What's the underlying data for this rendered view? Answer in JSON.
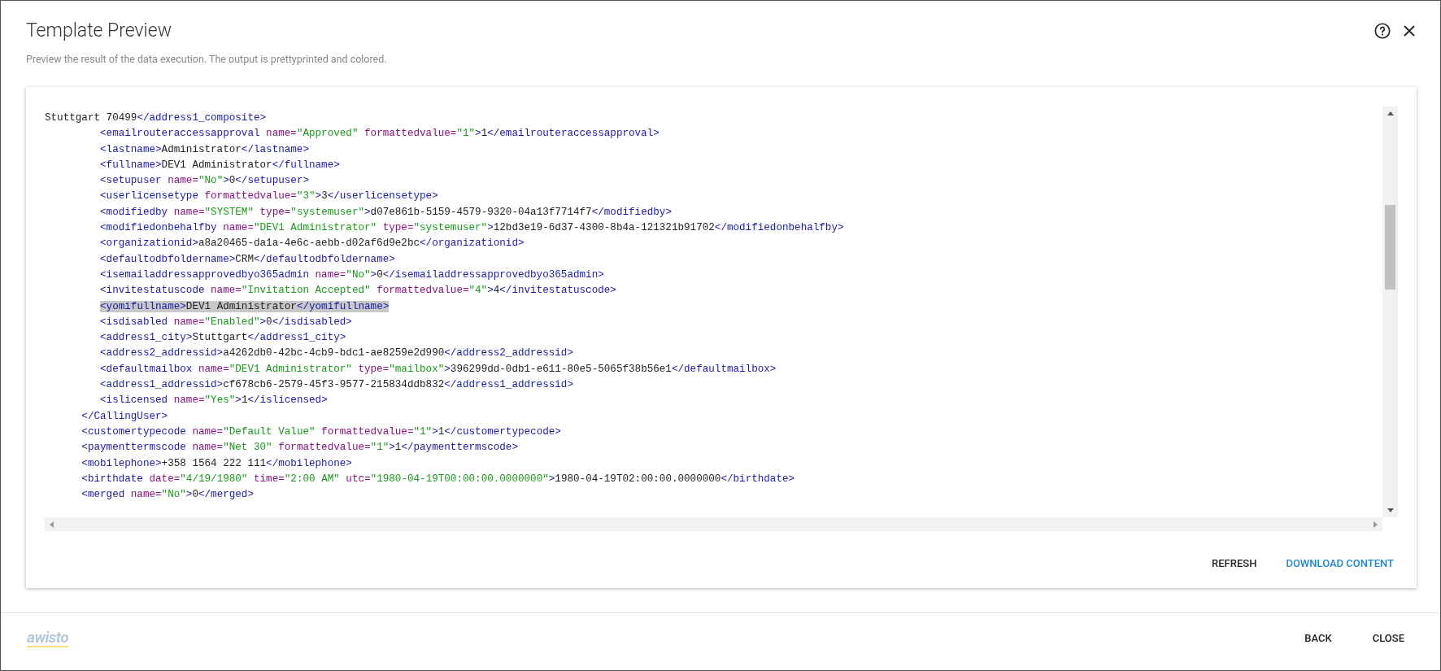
{
  "dialog": {
    "title": "Template Preview",
    "subtitle": "Preview the result of the data execution. The output is prettyprinted and colored."
  },
  "code_lines": [
    {
      "highlighted": false,
      "tokens": [
        {
          "kind": "text",
          "text": "Stuttgart 70499"
        },
        {
          "kind": "tag",
          "text": "</address1_composite>"
        }
      ]
    },
    {
      "highlighted": false,
      "tokens": [
        {
          "kind": "tag",
          "text": "         <emailrouteraccessapproval "
        },
        {
          "kind": "attr",
          "text": "name="
        },
        {
          "kind": "string",
          "text": "\"Approved\""
        },
        {
          "kind": "attr",
          "text": " formattedvalue="
        },
        {
          "kind": "string",
          "text": "\"1\""
        },
        {
          "kind": "tag",
          "text": ">"
        },
        {
          "kind": "text",
          "text": "1"
        },
        {
          "kind": "tag",
          "text": "</emailrouteraccessapproval>"
        }
      ]
    },
    {
      "highlighted": false,
      "tokens": [
        {
          "kind": "tag",
          "text": "         <lastname>"
        },
        {
          "kind": "text",
          "text": "Administrator"
        },
        {
          "kind": "tag",
          "text": "</lastname>"
        }
      ]
    },
    {
      "highlighted": false,
      "tokens": [
        {
          "kind": "tag",
          "text": "         <fullname>"
        },
        {
          "kind": "text",
          "text": "DEV1 Administrator"
        },
        {
          "kind": "tag",
          "text": "</fullname>"
        }
      ]
    },
    {
      "highlighted": false,
      "tokens": [
        {
          "kind": "tag",
          "text": "         <setupuser "
        },
        {
          "kind": "attr",
          "text": "name="
        },
        {
          "kind": "string",
          "text": "\"No\""
        },
        {
          "kind": "tag",
          "text": ">"
        },
        {
          "kind": "text",
          "text": "0"
        },
        {
          "kind": "tag",
          "text": "</setupuser>"
        }
      ]
    },
    {
      "highlighted": false,
      "tokens": [
        {
          "kind": "tag",
          "text": "         <userlicensetype "
        },
        {
          "kind": "attr",
          "text": "formattedvalue="
        },
        {
          "kind": "string",
          "text": "\"3\""
        },
        {
          "kind": "tag",
          "text": ">"
        },
        {
          "kind": "text",
          "text": "3"
        },
        {
          "kind": "tag",
          "text": "</userlicensetype>"
        }
      ]
    },
    {
      "highlighted": false,
      "tokens": [
        {
          "kind": "tag",
          "text": "         <modifiedby "
        },
        {
          "kind": "attr",
          "text": "name="
        },
        {
          "kind": "string",
          "text": "\"SYSTEM\""
        },
        {
          "kind": "attr",
          "text": " type="
        },
        {
          "kind": "string",
          "text": "\"systemuser\""
        },
        {
          "kind": "tag",
          "text": ">"
        },
        {
          "kind": "text",
          "text": "d07e861b-5159-4579-9320-04a13f7714f7"
        },
        {
          "kind": "tag",
          "text": "</modifiedby>"
        }
      ]
    },
    {
      "highlighted": false,
      "tokens": [
        {
          "kind": "tag",
          "text": "         <modifiedonbehalfby "
        },
        {
          "kind": "attr",
          "text": "name="
        },
        {
          "kind": "string",
          "text": "\"DEV1 Administrator\""
        },
        {
          "kind": "attr",
          "text": " type="
        },
        {
          "kind": "string",
          "text": "\"systemuser\""
        },
        {
          "kind": "tag",
          "text": ">"
        },
        {
          "kind": "text",
          "text": "12bd3e19-6d37-4300-8b4a-121321b91702"
        },
        {
          "kind": "tag",
          "text": "</modifiedonbehalfby>"
        }
      ]
    },
    {
      "highlighted": false,
      "tokens": [
        {
          "kind": "tag",
          "text": "         <organizationid>"
        },
        {
          "kind": "text",
          "text": "a8a20465-da1a-4e6c-aebb-d02af6d9e2bc"
        },
        {
          "kind": "tag",
          "text": "</organizationid>"
        }
      ]
    },
    {
      "highlighted": false,
      "tokens": [
        {
          "kind": "tag",
          "text": "         <defaultodbfoldername>"
        },
        {
          "kind": "text",
          "text": "CRM"
        },
        {
          "kind": "tag",
          "text": "</defaultodbfoldername>"
        }
      ]
    },
    {
      "highlighted": false,
      "tokens": [
        {
          "kind": "tag",
          "text": "         <isemailaddressapprovedbyo365admin "
        },
        {
          "kind": "attr",
          "text": "name="
        },
        {
          "kind": "string",
          "text": "\"No\""
        },
        {
          "kind": "tag",
          "text": ">"
        },
        {
          "kind": "text",
          "text": "0"
        },
        {
          "kind": "tag",
          "text": "</isemailaddressapprovedbyo365admin>"
        }
      ]
    },
    {
      "highlighted": false,
      "tokens": [
        {
          "kind": "tag",
          "text": "         <invitestatuscode "
        },
        {
          "kind": "attr",
          "text": "name="
        },
        {
          "kind": "string",
          "text": "\"Invitation Accepted\""
        },
        {
          "kind": "attr",
          "text": " formattedvalue="
        },
        {
          "kind": "string",
          "text": "\"4\""
        },
        {
          "kind": "tag",
          "text": ">"
        },
        {
          "kind": "text",
          "text": "4"
        },
        {
          "kind": "tag",
          "text": "</invitestatuscode>"
        }
      ]
    },
    {
      "highlighted": true,
      "tokens": [
        {
          "kind": "tag",
          "text": "         <yomifullname>"
        },
        {
          "kind": "text",
          "text": "DEV1 Administrator"
        },
        {
          "kind": "tag",
          "text": "</yomifullname>"
        }
      ]
    },
    {
      "highlighted": false,
      "tokens": [
        {
          "kind": "tag",
          "text": "         <isdisabled "
        },
        {
          "kind": "attr",
          "text": "name="
        },
        {
          "kind": "string",
          "text": "\"Enabled\""
        },
        {
          "kind": "tag",
          "text": ">"
        },
        {
          "kind": "text",
          "text": "0"
        },
        {
          "kind": "tag",
          "text": "</isdisabled>"
        }
      ]
    },
    {
      "highlighted": false,
      "tokens": [
        {
          "kind": "tag",
          "text": "         <address1_city>"
        },
        {
          "kind": "text",
          "text": "Stuttgart"
        },
        {
          "kind": "tag",
          "text": "</address1_city>"
        }
      ]
    },
    {
      "highlighted": false,
      "tokens": [
        {
          "kind": "tag",
          "text": "         <address2_addressid>"
        },
        {
          "kind": "text",
          "text": "a4262db0-42bc-4cb9-bdc1-ae8259e2d990"
        },
        {
          "kind": "tag",
          "text": "</address2_addressid>"
        }
      ]
    },
    {
      "highlighted": false,
      "tokens": [
        {
          "kind": "tag",
          "text": "         <defaultmailbox "
        },
        {
          "kind": "attr",
          "text": "name="
        },
        {
          "kind": "string",
          "text": "\"DEV1 Administrator\""
        },
        {
          "kind": "attr",
          "text": " type="
        },
        {
          "kind": "string",
          "text": "\"mailbox\""
        },
        {
          "kind": "tag",
          "text": ">"
        },
        {
          "kind": "text",
          "text": "396299dd-0db1-e611-80e5-5065f38b56e1"
        },
        {
          "kind": "tag",
          "text": "</defaultmailbox>"
        }
      ]
    },
    {
      "highlighted": false,
      "tokens": [
        {
          "kind": "tag",
          "text": "         <address1_addressid>"
        },
        {
          "kind": "text",
          "text": "cf678cb6-2579-45f3-9577-215834ddb832"
        },
        {
          "kind": "tag",
          "text": "</address1_addressid>"
        }
      ]
    },
    {
      "highlighted": false,
      "tokens": [
        {
          "kind": "tag",
          "text": "         <islicensed "
        },
        {
          "kind": "attr",
          "text": "name="
        },
        {
          "kind": "string",
          "text": "\"Yes\""
        },
        {
          "kind": "tag",
          "text": ">"
        },
        {
          "kind": "text",
          "text": "1"
        },
        {
          "kind": "tag",
          "text": "</islicensed>"
        }
      ]
    },
    {
      "highlighted": false,
      "tokens": [
        {
          "kind": "tag",
          "text": "      </CallingUser>"
        }
      ]
    },
    {
      "highlighted": false,
      "tokens": [
        {
          "kind": "tag",
          "text": "      <customertypecode "
        },
        {
          "kind": "attr",
          "text": "name="
        },
        {
          "kind": "string",
          "text": "\"Default Value\""
        },
        {
          "kind": "attr",
          "text": " formattedvalue="
        },
        {
          "kind": "string",
          "text": "\"1\""
        },
        {
          "kind": "tag",
          "text": ">"
        },
        {
          "kind": "text",
          "text": "1"
        },
        {
          "kind": "tag",
          "text": "</customertypecode>"
        }
      ]
    },
    {
      "highlighted": false,
      "tokens": [
        {
          "kind": "tag",
          "text": "      <paymenttermscode "
        },
        {
          "kind": "attr",
          "text": "name="
        },
        {
          "kind": "string",
          "text": "\"Net 30\""
        },
        {
          "kind": "attr",
          "text": " formattedvalue="
        },
        {
          "kind": "string",
          "text": "\"1\""
        },
        {
          "kind": "tag",
          "text": ">"
        },
        {
          "kind": "text",
          "text": "1"
        },
        {
          "kind": "tag",
          "text": "</paymenttermscode>"
        }
      ]
    },
    {
      "highlighted": false,
      "tokens": [
        {
          "kind": "tag",
          "text": "      <mobilephone>"
        },
        {
          "kind": "text",
          "text": "+358 1564 222 111"
        },
        {
          "kind": "tag",
          "text": "</mobilephone>"
        }
      ]
    },
    {
      "highlighted": false,
      "tokens": [
        {
          "kind": "tag",
          "text": "      <birthdate "
        },
        {
          "kind": "attr",
          "text": "date="
        },
        {
          "kind": "string",
          "text": "\"4/19/1980\""
        },
        {
          "kind": "attr",
          "text": " time="
        },
        {
          "kind": "string",
          "text": "\"2:00 AM\""
        },
        {
          "kind": "attr",
          "text": " utc="
        },
        {
          "kind": "string",
          "text": "\"1980-04-19T00:00:00.0000000\""
        },
        {
          "kind": "tag",
          "text": ">"
        },
        {
          "kind": "text",
          "text": "1980-04-19T02:00:00.0000000"
        },
        {
          "kind": "tag",
          "text": "</birthdate>"
        }
      ]
    },
    {
      "highlighted": false,
      "tokens": [
        {
          "kind": "tag",
          "text": "      <merged "
        },
        {
          "kind": "attr",
          "text": "name="
        },
        {
          "kind": "string",
          "text": "\"No\""
        },
        {
          "kind": "tag",
          "text": ">"
        },
        {
          "kind": "text",
          "text": "0"
        },
        {
          "kind": "tag",
          "text": "</merged>"
        }
      ]
    }
  ],
  "card_actions": [
    {
      "label": "REFRESH",
      "kind": "plain"
    },
    {
      "label": "DOWNLOAD CONTENT",
      "kind": "primary"
    }
  ],
  "footer": {
    "logo": "awisto",
    "actions": [
      "BACK",
      "CLOSE"
    ]
  }
}
